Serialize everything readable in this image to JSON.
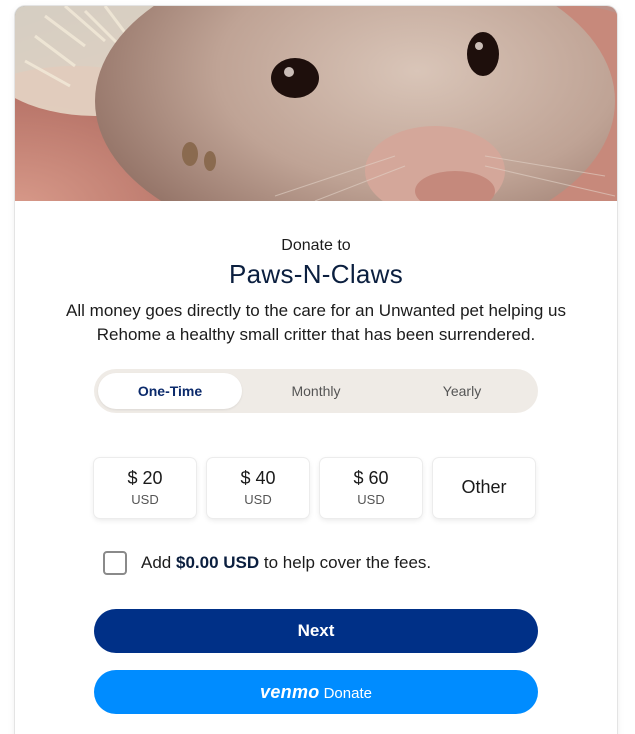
{
  "hero": {
    "image_alt": "hedgehog-photo"
  },
  "header": {
    "pre_title": "Donate to",
    "org_name": "Paws-N-Claws",
    "description": "All money goes directly to the care for an Unwanted pet helping us Rehome a healthy small critter that has been surrendered."
  },
  "frequency": {
    "tabs": [
      {
        "label": "One-Time",
        "active": true
      },
      {
        "label": "Monthly",
        "active": false
      },
      {
        "label": "Yearly",
        "active": false
      }
    ]
  },
  "amounts": [
    {
      "value": "$ 20",
      "currency": "USD"
    },
    {
      "value": "$ 40",
      "currency": "USD"
    },
    {
      "value": "$ 60",
      "currency": "USD"
    },
    {
      "value": "Other",
      "currency": ""
    }
  ],
  "fees": {
    "checked": false,
    "prefix": "Add ",
    "amount": "$0.00 USD",
    "suffix": " to help cover the fees."
  },
  "buttons": {
    "next_label": "Next",
    "venmo_logo": "venmo",
    "venmo_label": "Donate"
  },
  "colors": {
    "primary": "#003087",
    "venmo": "#008cff",
    "tab_track": "#efebe6"
  }
}
